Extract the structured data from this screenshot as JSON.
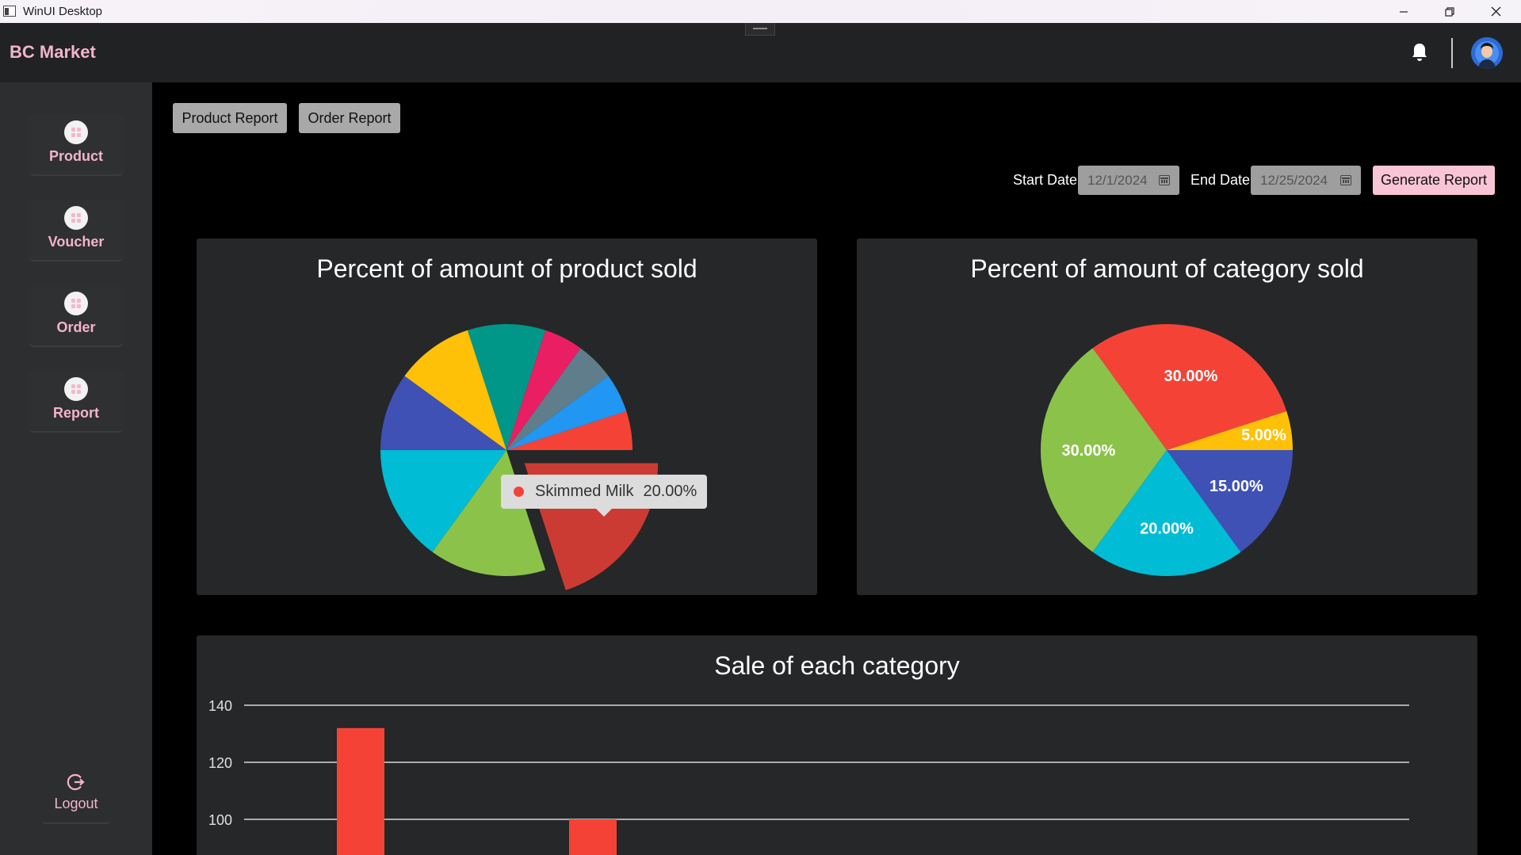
{
  "window": {
    "title": "WinUI Desktop"
  },
  "app": {
    "brand": "BC Market"
  },
  "sidebar": {
    "items": [
      {
        "label": "Product"
      },
      {
        "label": "Voucher"
      },
      {
        "label": "Order"
      },
      {
        "label": "Report"
      }
    ],
    "logout": "Logout"
  },
  "tabs": {
    "product_report": "Product Report",
    "order_report": "Order Report"
  },
  "filters": {
    "start_label": "Start Date:",
    "start_value": "12/1/2024",
    "end_label": "End Date:",
    "end_value": "12/25/2024",
    "generate": "Generate Report"
  },
  "chart_data": [
    {
      "type": "pie",
      "title": "Percent of amount of product sold",
      "slices": [
        {
          "value": 5.0,
          "color": "#f44336"
        },
        {
          "value": 5.0,
          "color": "#2196f3"
        },
        {
          "value": 5.0,
          "color": "#607d8b"
        },
        {
          "value": 5.0,
          "color": "#e91e63"
        },
        {
          "value": 10.0,
          "color": "#009688"
        },
        {
          "value": 10.0,
          "color": "#ffc107"
        },
        {
          "value": 10.0,
          "color": "#3f51b5"
        },
        {
          "value": 15.0,
          "color": "#00bcd4"
        },
        {
          "value": 15.0,
          "color": "#8bc34a"
        },
        {
          "name": "Skimmed Milk",
          "value": 20.0,
          "color": "#cc3b33",
          "exploded": true
        }
      ],
      "tooltip": {
        "name": "Skimmed Milk",
        "value": "20.00%"
      }
    },
    {
      "type": "pie",
      "title": "Percent of amount of category sold",
      "slices": [
        {
          "value": 5.0,
          "label": "5.00%",
          "color": "#ffc107"
        },
        {
          "value": 30.0,
          "label": "30.00%",
          "color": "#f44336"
        },
        {
          "value": 30.0,
          "label": "30.00%",
          "color": "#8bc34a"
        },
        {
          "value": 20.0,
          "label": "20.00%",
          "color": "#00bcd4"
        },
        {
          "value": 15.0,
          "label": "15.00%",
          "color": "#3f51b5"
        }
      ]
    },
    {
      "type": "bar",
      "title": "Sale of each category",
      "y_ticks": [
        "140",
        "120",
        "100"
      ],
      "ylim_visible": [
        90,
        140
      ],
      "values": [
        132,
        100
      ],
      "color": "#f44336"
    }
  ]
}
